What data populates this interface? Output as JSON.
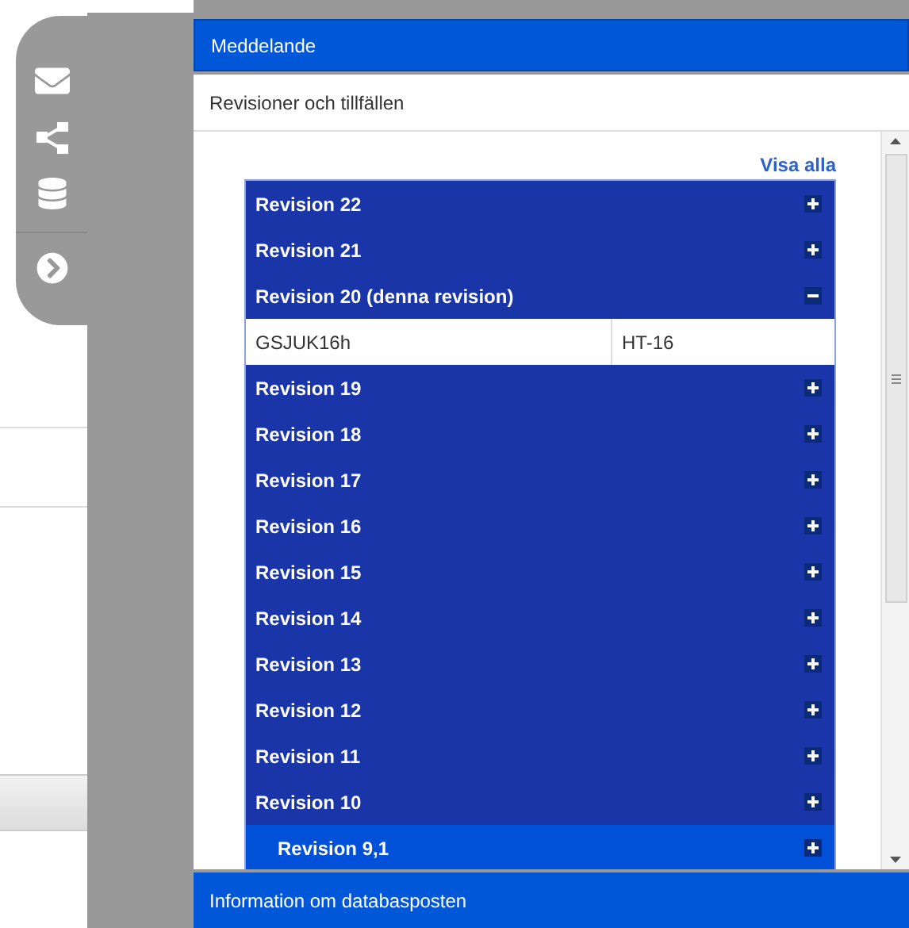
{
  "panel": {
    "title": "Meddelande",
    "subtitle": "Revisioner och tillfällen",
    "show_all": "Visa alla",
    "revisions": [
      {
        "label": "Revision 22",
        "kind": "main",
        "expanded": false
      },
      {
        "label": "Revision 21",
        "kind": "main",
        "expanded": false
      },
      {
        "label": "Revision 20 (denna revision)",
        "kind": "main",
        "expanded": true,
        "details": [
          "GSJUK16h",
          "HT-16"
        ]
      },
      {
        "label": "Revision 19",
        "kind": "main",
        "expanded": false
      },
      {
        "label": "Revision 18",
        "kind": "main",
        "expanded": false
      },
      {
        "label": "Revision 17",
        "kind": "main",
        "expanded": false
      },
      {
        "label": "Revision 16",
        "kind": "main",
        "expanded": false
      },
      {
        "label": "Revision 15",
        "kind": "main",
        "expanded": false
      },
      {
        "label": "Revision 14",
        "kind": "main",
        "expanded": false
      },
      {
        "label": "Revision 13",
        "kind": "main",
        "expanded": false
      },
      {
        "label": "Revision 12",
        "kind": "main",
        "expanded": false
      },
      {
        "label": "Revision 11",
        "kind": "main",
        "expanded": false
      },
      {
        "label": "Revision 10",
        "kind": "main",
        "expanded": false
      },
      {
        "label": "Revision 9,1",
        "kind": "sub",
        "expanded": false
      }
    ],
    "footer": "Information om databasposten"
  }
}
